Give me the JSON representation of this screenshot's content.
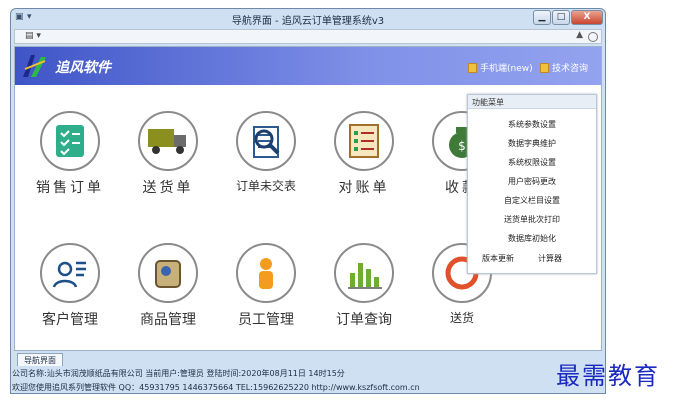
{
  "window": {
    "title": "导航界面 - 追风云订单管理系统v3",
    "min": "▁",
    "max": "□",
    "close": "X"
  },
  "toolbar": {
    "menu": "▤ ▾",
    "up": "▲"
  },
  "banner": {
    "app_name": "追风软件",
    "link_mobile": "手机端(new)",
    "link_support": "技术咨询"
  },
  "tiles": [
    {
      "label": "销售订单",
      "icon": "sales-order-icon"
    },
    {
      "label": "送货单",
      "icon": "delivery-truck-icon"
    },
    {
      "label": "订单未交表",
      "icon": "search-document-icon"
    },
    {
      "label": "对账单",
      "icon": "statement-icon"
    },
    {
      "label": "收款",
      "icon": "money-bag-icon"
    },
    {
      "label": "客户管理",
      "icon": "customer-icon"
    },
    {
      "label": "商品管理",
      "icon": "product-icon"
    },
    {
      "label": "员工管理",
      "icon": "employee-icon"
    },
    {
      "label": "订单查询",
      "icon": "chart-icon"
    },
    {
      "label": "送货",
      "icon": "delivery-query-icon"
    }
  ],
  "panel": {
    "title": "功能菜单",
    "items": [
      "系统参数设置",
      "数据字典维护",
      "系统权限设置",
      "用户密码更改",
      "自定义栏目设置",
      "送货单批次打印",
      "数据库初始化"
    ],
    "btn_version": "版本更新",
    "btn_calc": "计算器"
  },
  "status": {
    "tab": "导航界面",
    "company_line": "公司名称:汕头市润茂顺纸品有限公司 当前用户:管理员 登陆时间:2020年08月11日 14时15分",
    "welcome_line": "欢迎您使用追风系列管理软件 QQ：45931795 1446375664 TEL:15962625220 http://www.kszfsoft.com.cn"
  },
  "watermark": "最需教育",
  "colors": {
    "banner": "#3f55c7",
    "window": "#cfe0f2"
  }
}
